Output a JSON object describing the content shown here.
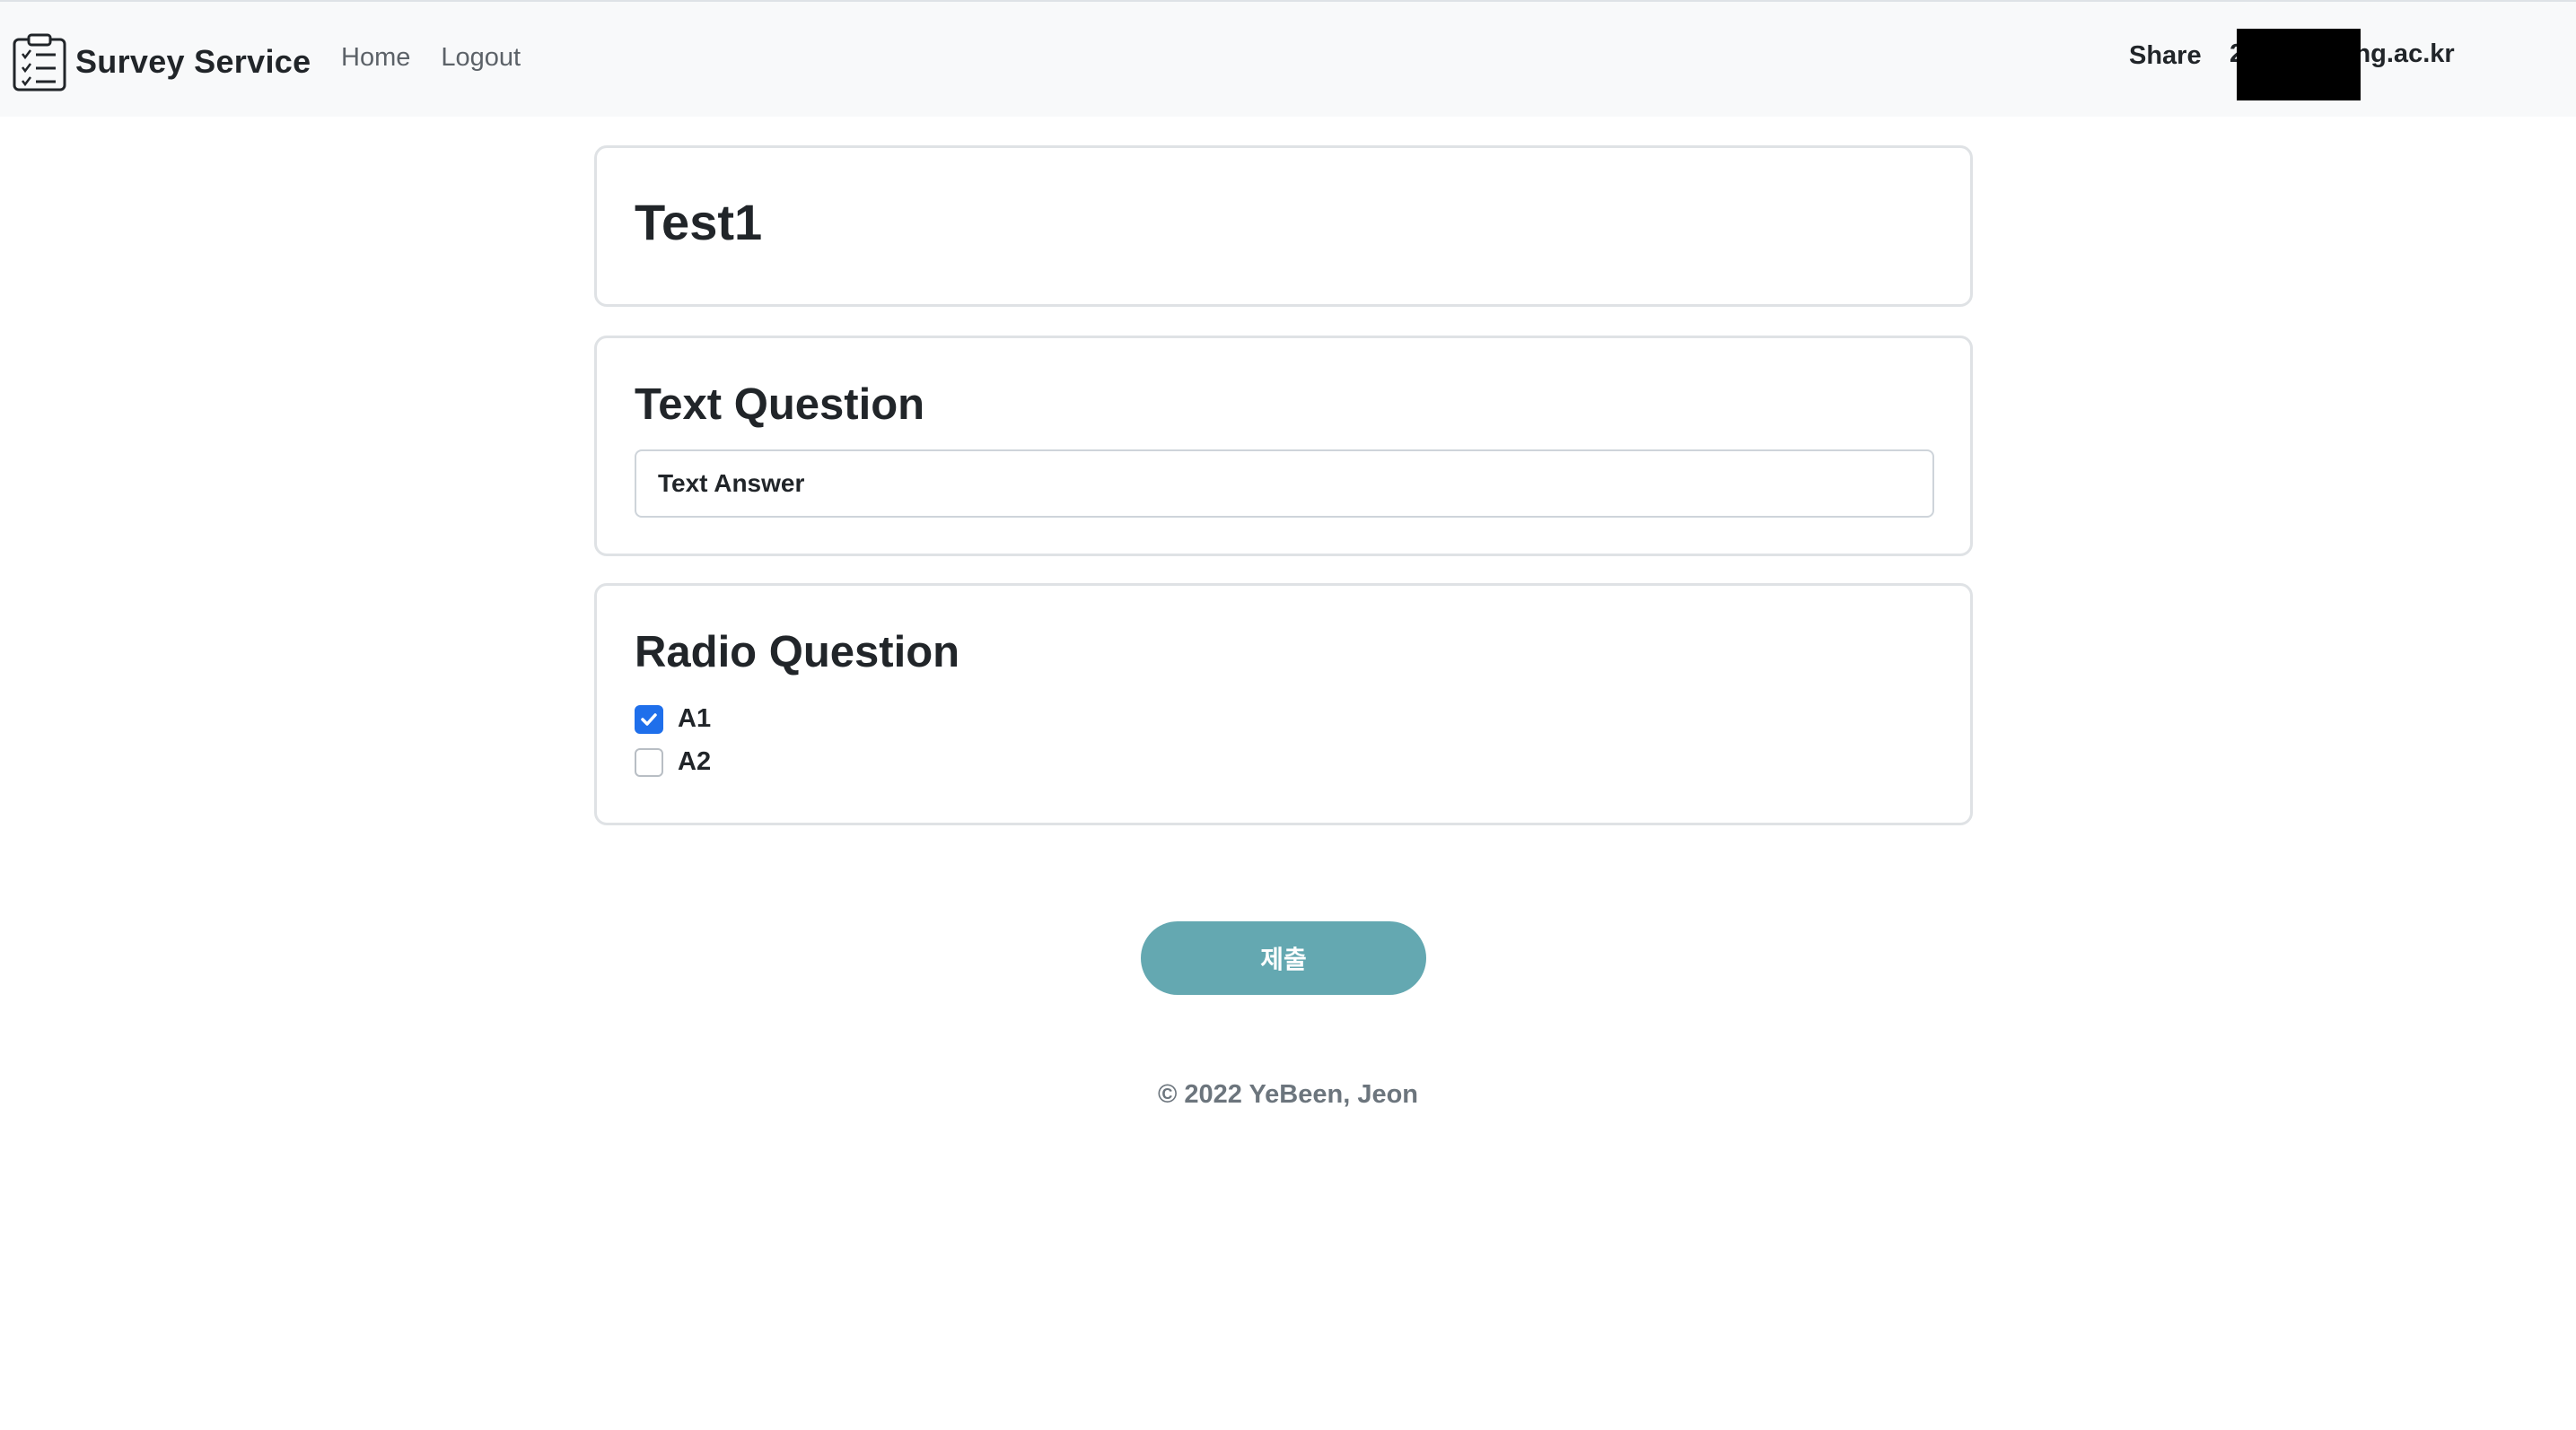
{
  "navbar": {
    "brand": "Survey Service",
    "brand_icon": "clipboard-checklist-icon",
    "links": [
      "Home",
      "Logout"
    ],
    "share_label": "Share",
    "user_email": "2          @handong.ac.kr"
  },
  "survey": {
    "title": "Test1",
    "questions": [
      {
        "title": "Text Question",
        "type": "text",
        "answer_value": "Text Answer"
      },
      {
        "title": "Radio Question",
        "type": "checkbox",
        "options": [
          {
            "label": "A1",
            "checked": true
          },
          {
            "label": "A2",
            "checked": false
          }
        ]
      }
    ]
  },
  "submit_label": "제출",
  "footer": "© 2022 YeBeen, Jeon",
  "colors": {
    "navbar_bg": "#f8f9fa",
    "submit_bg": "#64a8b1",
    "checkbox_checked": "#1f6feb"
  }
}
